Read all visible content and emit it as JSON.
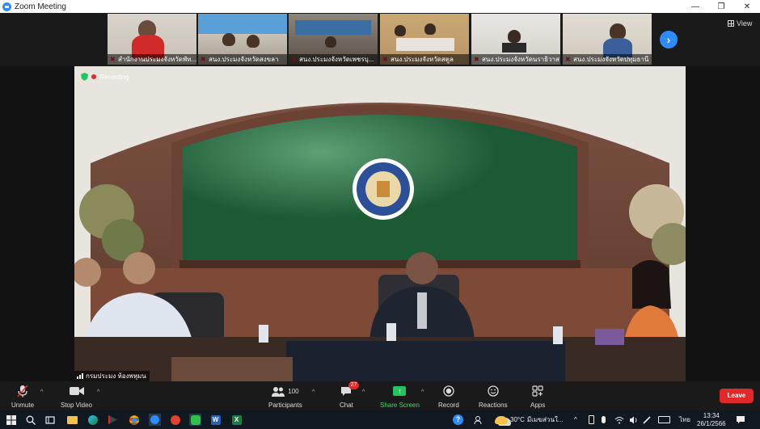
{
  "window": {
    "title": "Zoom Meeting",
    "minimize": "—",
    "restore": "❐",
    "close": "✕"
  },
  "gallery": {
    "tiles": [
      {
        "name": "สำนักงานประมงจังหวัดพัท..."
      },
      {
        "name": "สนง.ประมงจังหวัดสงขลา"
      },
      {
        "name": "สนง.ประมงจังหวัดเพชรบุ..."
      },
      {
        "name": "สนง.ประมงจังหวัดสตูล"
      },
      {
        "name": "สนง.ประมงจังหวัดนราธิวาส"
      },
      {
        "name": "สนง.ประมงจังหวัดปทุมธานี"
      }
    ],
    "next_glyph": "›",
    "view_label": "View"
  },
  "main_video": {
    "recording_label": "Recording",
    "speaker_name": "กรมประมง ห้องพหุมน"
  },
  "toolbar": {
    "unmute": "Unmute",
    "stop_video": "Stop Video",
    "participants": "Participants",
    "participants_count": "100",
    "chat": "Chat",
    "chat_badge": "27",
    "share_screen": "Share Screen",
    "record": "Record",
    "reactions": "Reactions",
    "apps": "Apps",
    "leave": "Leave"
  },
  "taskbar": {
    "weather": "30°C",
    "weather_desc": "มีเมฆส่วนใ...",
    "language": "ไทย",
    "time": "13:34",
    "date": "26/1/2566"
  }
}
